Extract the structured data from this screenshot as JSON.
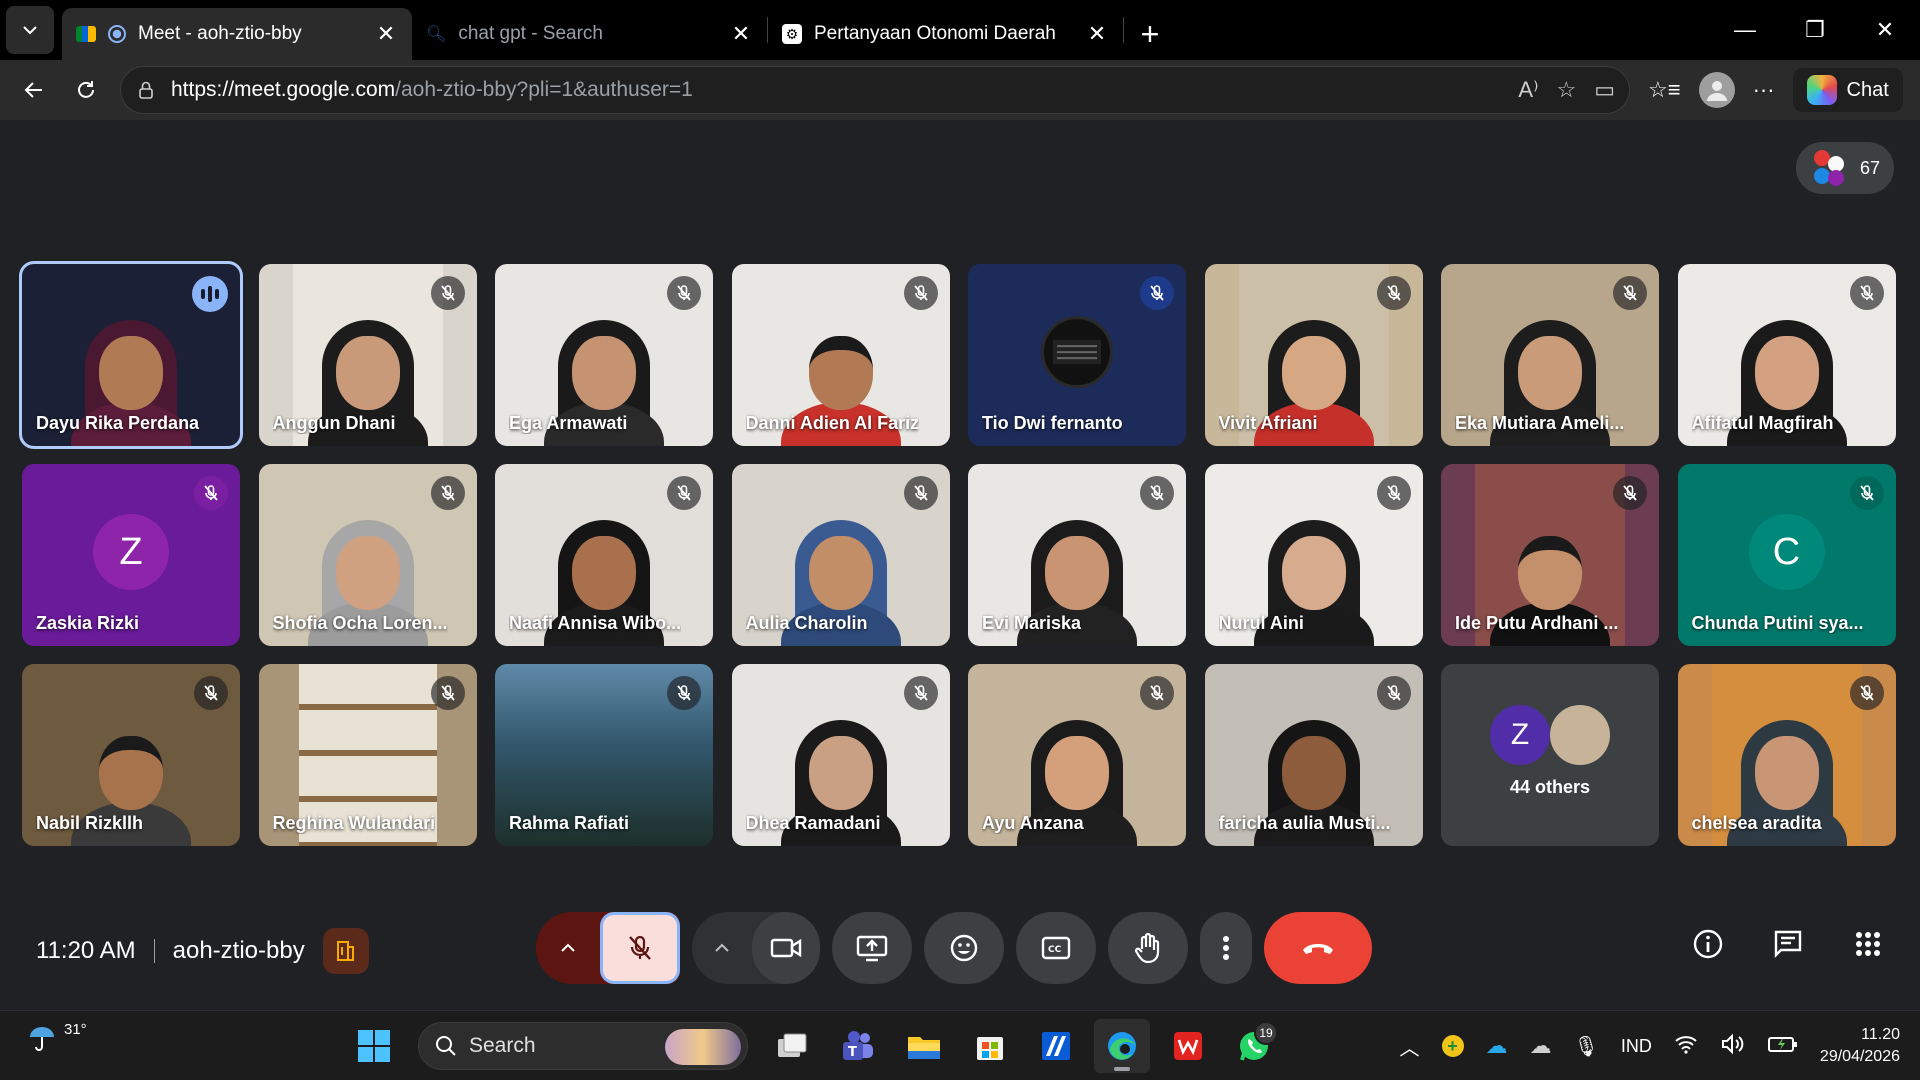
{
  "browser": {
    "tabs": [
      {
        "title": "Meet - aoh-ztio-bby",
        "active": true
      },
      {
        "title": "chat gpt - Search",
        "active": false
      },
      {
        "title": "Pertanyaan Otonomi Daerah",
        "active": false
      }
    ],
    "url_host": "https://meet.google.com",
    "url_path": "/aoh-ztio-bby?pli=1&authuser=1",
    "chat_label": "Chat"
  },
  "meet": {
    "participant_count": "67",
    "participants": [
      {
        "name": "Dayu Rika Perdana",
        "type": "video",
        "speaking": true,
        "bg": "#1b2036",
        "skin": "#b07a55",
        "cloth": "#5b1d3a",
        "hijab": "#4a1830",
        "frame": "#1b2036"
      },
      {
        "name": "Anggun Dhani",
        "type": "video",
        "bg": "#d9d5cc",
        "skin": "#c89a7a",
        "cloth": "#1c1c1c",
        "hijab": "#1c1c1c",
        "frame": "#eae6de"
      },
      {
        "name": "Ega Armawati",
        "type": "video",
        "bg": "#e8e6e3",
        "skin": "#c59272",
        "cloth": "#2a2a2a",
        "hijab": "#1a1a1a",
        "frame": "#e8e6e3"
      },
      {
        "name": "Danni Adien Al Fariz",
        "type": "video",
        "bg": "#e9e7e4",
        "skin": "#b17a55",
        "cloth": "#c8322b",
        "hijab": "",
        "frame": "#e9e7e4"
      },
      {
        "name": "Tio Dwi fernanto",
        "type": "logo",
        "bg": "#1d2b5a",
        "mic_color": "#1e3a8a"
      },
      {
        "name": "Vivit Afriani",
        "type": "video",
        "bg": "#c9b79a",
        "skin": "#d5a883",
        "cloth": "#c5302a",
        "hijab": "#1c1c1c",
        "frame": "#cbbfa8"
      },
      {
        "name": "Eka Mutiara Ameli...",
        "type": "video",
        "bg": "#b7a68b",
        "skin": "#c99b78",
        "cloth": "#1f1f1f",
        "hijab": "#1d1d1d",
        "frame": "#b7a68b"
      },
      {
        "name": "Afifatul Magfirah",
        "type": "video",
        "bg": "#eceae6",
        "skin": "#d3a181",
        "cloth": "#1a1a1a",
        "hijab": "#1a1a1a",
        "frame": "#eceae6"
      },
      {
        "name": "Zaskia Rizki",
        "type": "letter",
        "letter": "Z",
        "bg": "#6a1b9a",
        "avatar": "#8e24aa",
        "mic_color": "#7b1fa2"
      },
      {
        "name": "Shofia Ocha Loren...",
        "type": "video",
        "bg": "#d0c6b4",
        "skin": "#cfa180",
        "cloth": "#9c9c9c",
        "hijab": "#a7a7a7",
        "frame": "#d0c6b4"
      },
      {
        "name": "Naafi Annisa Wibo...",
        "type": "video",
        "bg": "#e2dfda",
        "skin": "#a8704c",
        "cloth": "#1b1b1b",
        "hijab": "#151515",
        "frame": "#e2dfda"
      },
      {
        "name": "Aulia Charolin",
        "type": "video",
        "bg": "#d8d4cc",
        "skin": "#c28e68",
        "cloth": "#2e4a7a",
        "hijab": "#3a5a92",
        "frame": "#d8d4cc"
      },
      {
        "name": "Evi Mariska",
        "type": "video",
        "bg": "#e9e7e3",
        "skin": "#c99472",
        "cloth": "#222",
        "hijab": "#1b1b1b",
        "frame": "#e9e7e3"
      },
      {
        "name": "Nurul Aini",
        "type": "video",
        "bg": "#ecebe8",
        "skin": "#d7ab8d",
        "cloth": "#1a1a1a",
        "hijab": "#1c1c1c",
        "frame": "#ecebe8"
      },
      {
        "name": "Ide Putu Ardhani ...",
        "type": "video",
        "bg": "#6b3c52",
        "skin": "#c48f6b",
        "cloth": "#111",
        "hijab": "",
        "frame": "#8a4d4a"
      },
      {
        "name": "Chunda Putini sya...",
        "type": "letter",
        "letter": "C",
        "bg": "#00796b",
        "avatar": "#00897b",
        "mic_color": "#00695c"
      },
      {
        "name": "Nabil Rizkllh",
        "type": "video",
        "bg": "#6e5a3e",
        "skin": "#a7734d",
        "cloth": "#3a3a3a",
        "hijab": "",
        "frame": "#6e5a3e"
      },
      {
        "name": "Reghina Wulandari",
        "type": "books",
        "bg": "#a89477"
      },
      {
        "name": "Rahma Rafiati",
        "type": "landscape",
        "bg": "#2f4a5c"
      },
      {
        "name": "Dhea Ramadani",
        "type": "video",
        "bg": "#e6e4e0",
        "skin": "#caa084",
        "cloth": "#1a1a1a",
        "hijab": "#1a1a1a",
        "frame": "#e6e4e0"
      },
      {
        "name": "Ayu Anzana",
        "type": "video",
        "bg": "#c4b49b",
        "skin": "#d4a07c",
        "cloth": "#1e1e1e",
        "hijab": "#1b1b1b",
        "frame": "#c4b49b"
      },
      {
        "name": "faricha aulia Musti...",
        "type": "video",
        "bg": "#c4bfb6",
        "skin": "#8c5c3c",
        "cloth": "#1b1b1b",
        "hijab": "#151515",
        "frame": "#c4bfb6"
      },
      {
        "name": "44 others",
        "type": "others",
        "letter": "Z"
      },
      {
        "name": "chelsea aradita",
        "type": "video",
        "bg": "#c98a4a",
        "skin": "#c89575",
        "cloth": "#2f3b44",
        "hijab": "#2d3a42",
        "frame": "#d48e3e"
      }
    ]
  },
  "controls": {
    "time": "11:20 AM",
    "meeting_code": "aoh-ztio-bby"
  },
  "taskbar": {
    "temperature": "31°",
    "search_placeholder": "Search",
    "whatsapp_badge": "19",
    "language": "IND",
    "clock_time": "11.20",
    "clock_date": "29/04/2026"
  }
}
